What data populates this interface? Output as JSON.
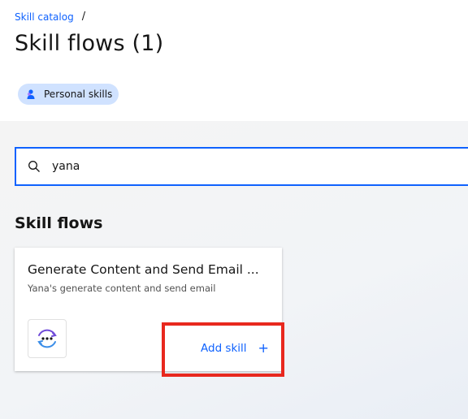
{
  "breadcrumb": {
    "link_label": "Skill catalog",
    "separator": "/"
  },
  "header": {
    "title": "Skill flows (1)"
  },
  "filter_tag": {
    "label": "Personal skills",
    "icon": "person-icon"
  },
  "search": {
    "value": "yana",
    "icon": "search-icon"
  },
  "section": {
    "title": "Skill flows"
  },
  "card": {
    "title": "Generate Content and Send Email ...",
    "description": "Yana's generate content and send email",
    "logo_icon": "flow-logo-icon",
    "add_label": "Add skill",
    "add_icon": "plus-icon"
  },
  "colors": {
    "accent": "#0f62fe",
    "tag_bg": "#d0e2ff",
    "highlight": "#e8281e"
  }
}
